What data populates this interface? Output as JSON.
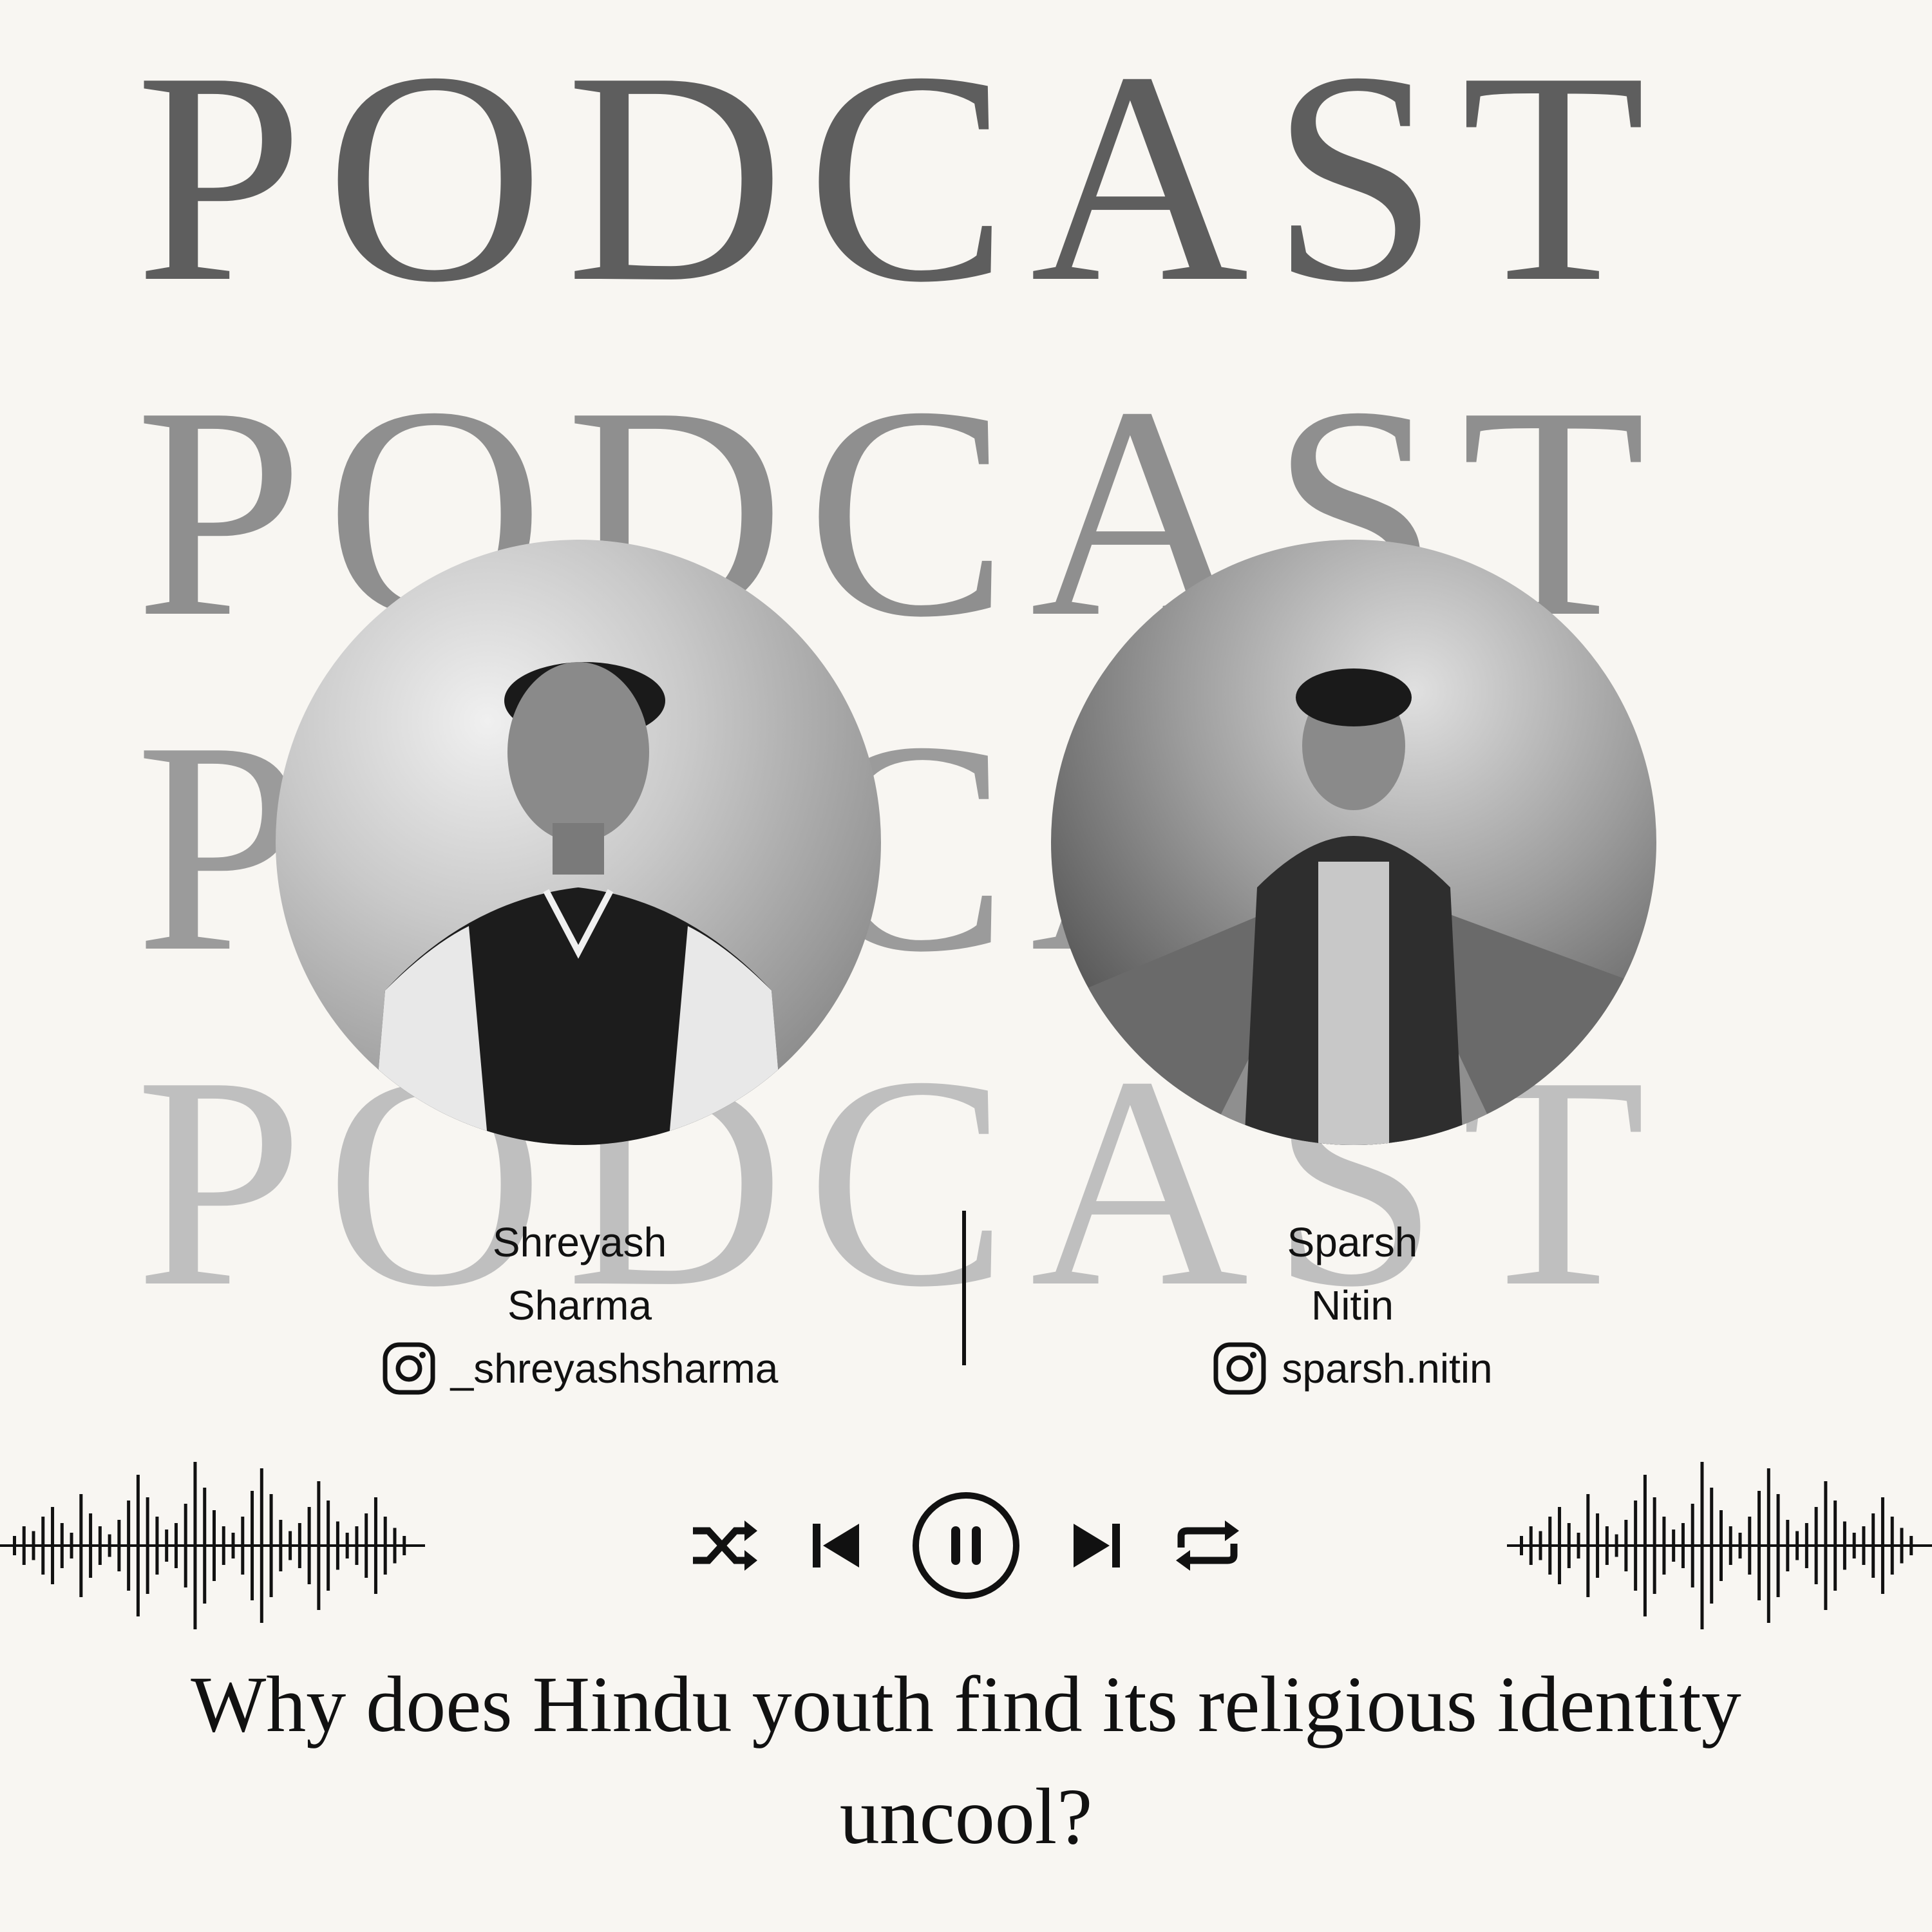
{
  "background": {
    "word": "PODCAST",
    "colors": [
      "#5e5e5e",
      "#8f8f8f",
      "#9b9b9b",
      "#bfbfbf"
    ]
  },
  "hosts": [
    {
      "first_name": "Shreyash",
      "last_name": "Sharma",
      "handle": "_shreyashsharma",
      "icon": "instagram-icon",
      "photo": "black-and-white-portrait"
    },
    {
      "first_name": "Sparsh",
      "last_name": "Nitin",
      "handle": "sparsh.nitin",
      "icon": "instagram-icon",
      "photo": "black-and-white-portrait"
    }
  ],
  "player": {
    "controls": [
      "shuffle-icon",
      "previous-icon",
      "pause-icon",
      "next-icon",
      "repeat-icon"
    ],
    "color": "#111111"
  },
  "question": "Why does Hindu youth find its religious identity uncool?"
}
